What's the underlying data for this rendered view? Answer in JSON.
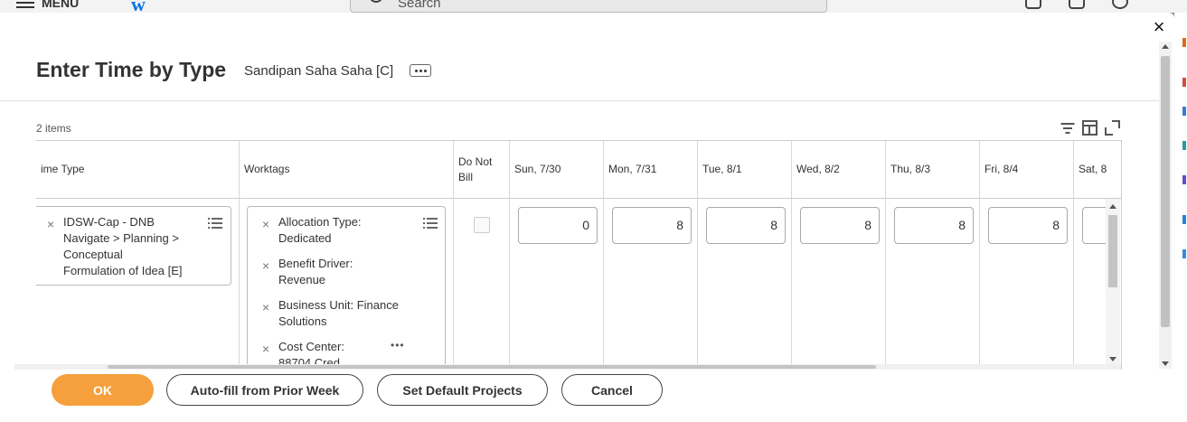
{
  "background_app": {
    "menu_label": "MENU",
    "logo_letter": "w",
    "search_placeholder": "Search"
  },
  "dialog": {
    "title": "Enter Time by Type",
    "subtitle": "Sandipan Saha Saha [C]",
    "close_glyph": "×",
    "items_count": "2 items",
    "columns": [
      {
        "key": "time_type",
        "label": "ime Type"
      },
      {
        "key": "worktags",
        "label": "Worktags"
      },
      {
        "key": "do_not_bill",
        "label": "Do Not Bill"
      },
      {
        "key": "sun",
        "label": "Sun, 7/30"
      },
      {
        "key": "mon",
        "label": "Mon, 7/31"
      },
      {
        "key": "tue",
        "label": "Tue, 8/1"
      },
      {
        "key": "wed",
        "label": "Wed, 8/2"
      },
      {
        "key": "thu",
        "label": "Thu, 8/3"
      },
      {
        "key": "fri",
        "label": "Fri, 8/4"
      },
      {
        "key": "sat",
        "label": "Sat, 8"
      }
    ],
    "row": {
      "time_type": {
        "line1": "IDSW-Cap - DNB",
        "line2": "Navigate > Planning >",
        "line3": "Conceptual",
        "line4": "Formulation of Idea [E]"
      },
      "worktags": [
        {
          "line1": "Allocation Type:",
          "line2": "Dedicated"
        },
        {
          "line1": "Benefit Driver:",
          "line2": "Revenue"
        },
        {
          "line1": "Business Unit: Finance",
          "line2": "Solutions"
        },
        {
          "line1": "Cost Center:",
          "line2": "88704 Cred"
        }
      ],
      "do_not_bill": false,
      "hours": {
        "sun": "0",
        "mon": "8",
        "tue": "8",
        "wed": "8",
        "thu": "8",
        "fri": "8",
        "sat": ""
      }
    },
    "buttons": {
      "ok": "OK",
      "autofill": "Auto-fill from Prior Week",
      "set_default": "Set Default Projects",
      "cancel": "Cancel"
    }
  },
  "colors": {
    "primary_button": "#f5a03c",
    "logo_blue": "#0875e1",
    "badge_red": "#d9342b"
  }
}
